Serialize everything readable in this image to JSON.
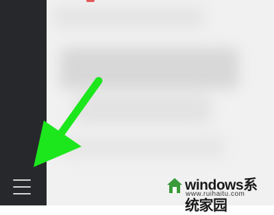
{
  "sidebar": {
    "menu_icon": "hamburger-menu-icon"
  },
  "annotation": {
    "arrow_color": "#19e619",
    "arrow_icon": "arrow-down-left-icon"
  },
  "content": {
    "state": "blurred"
  },
  "watermark": {
    "brand": "windows系统家园",
    "url": "www.ruihaitu.com",
    "logo_icon": "house-logo-icon"
  }
}
